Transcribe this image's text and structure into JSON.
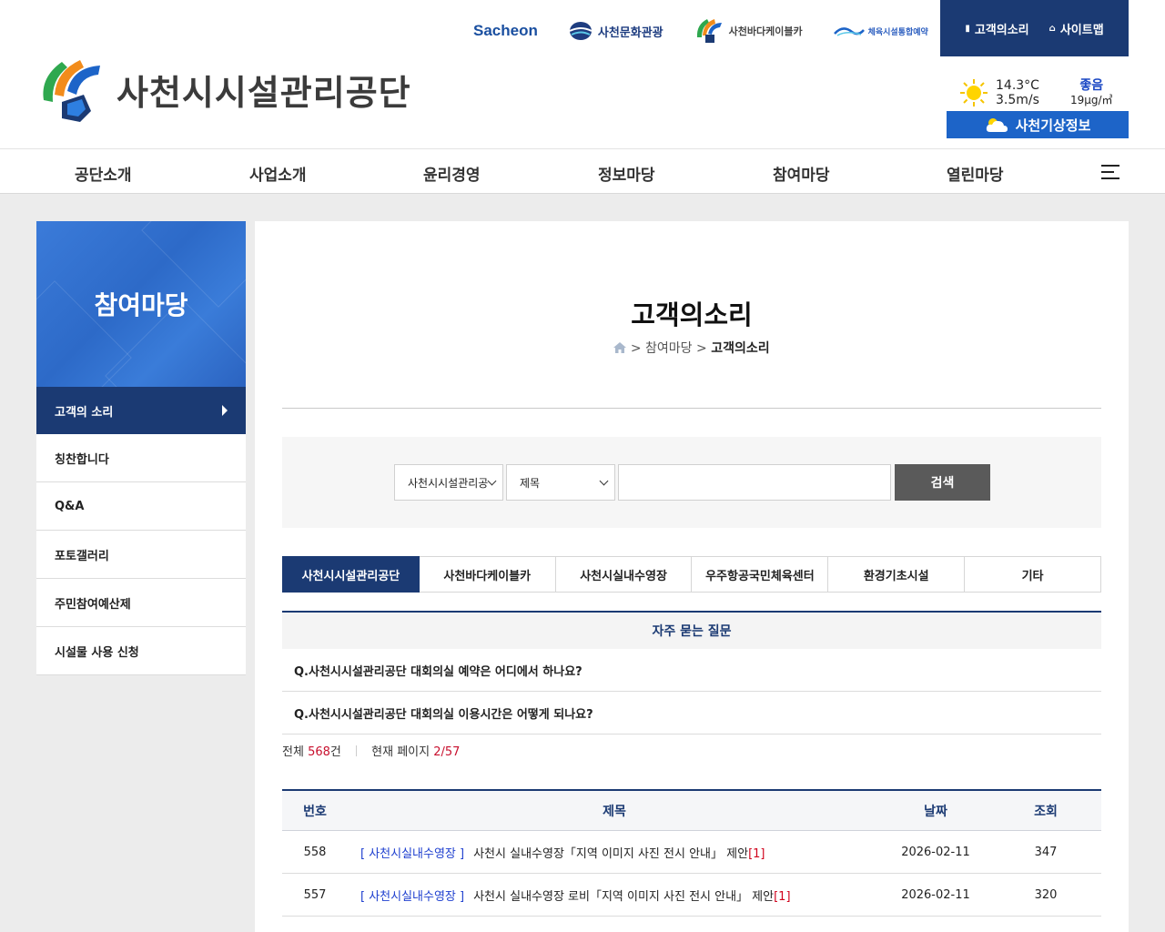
{
  "header": {
    "org_name": "사천시시설관리공단",
    "family_sites": {
      "sacheon": "Sacheon",
      "culture": "사천문화관광",
      "cablecar": "사천바다케이블카",
      "sports": "체육시설통합예약"
    },
    "top_links": {
      "voice": "고객의소리",
      "sitemap": "사이트맵"
    },
    "weather": {
      "temp": "14.3°C",
      "wind": "3.5m/s",
      "air_grade": "좋음",
      "air_value": "19μg/㎥",
      "button": "사천기상정보"
    }
  },
  "gnb": {
    "items": [
      "공단소개",
      "사업소개",
      "윤리경영",
      "정보마당",
      "참여마당",
      "열린마당"
    ]
  },
  "side": {
    "title": "참여마당",
    "items": [
      "고객의 소리",
      "칭찬합니다",
      "Q&A",
      "포토갤러리",
      "주민참여예산제",
      "시설물 사용 신청"
    ]
  },
  "main": {
    "title": "고객의소리",
    "breadcrumb": {
      "sep": ">",
      "parent": "참여마당",
      "current": "고객의소리"
    },
    "search": {
      "org_select": "사천시시설관리공",
      "field_select": "제목",
      "input_value": "",
      "button": "검색"
    },
    "tabs": [
      "사천시시설관리공단",
      "사천바다케이블카",
      "사천시실내수영장",
      "우주항공국민체육센터",
      "환경기초시설",
      "기타"
    ],
    "faq": {
      "title": "자주 묻는 질문",
      "items": [
        "Q.사천시시설관리공단 대회의실 예약은 어디에서 하나요?",
        "Q.사천시시설관리공단 대회의실 이용시간은 어떻게 되나요?"
      ]
    },
    "count": {
      "total_label": "전체",
      "total": "568",
      "total_unit": "건",
      "page_label": "현재 페이지",
      "page": "2/57"
    },
    "board": {
      "headers": {
        "no": "번호",
        "title": "제목",
        "date": "날짜",
        "views": "조회"
      },
      "rows": [
        {
          "no": "558",
          "category": "[ 사천시실내수영장 ]",
          "title": "사천시 실내수영장「지역 이미지 사진 전시 안내」 제안",
          "comments": "[1]",
          "date": "2026-02-11",
          "views": "347"
        },
        {
          "no": "557",
          "category": "[ 사천시실내수영장 ]",
          "title": "사천시 실내수영장 로비「지역 이미지 사진 전시 안내」 제안",
          "comments": "[1]",
          "date": "2026-02-11",
          "views": "320"
        }
      ]
    }
  },
  "colors": {
    "navy": "#1b3a73",
    "blue": "#1d64c8",
    "accent_red": "#c8102e",
    "category_blue": "#1e3fcf"
  }
}
